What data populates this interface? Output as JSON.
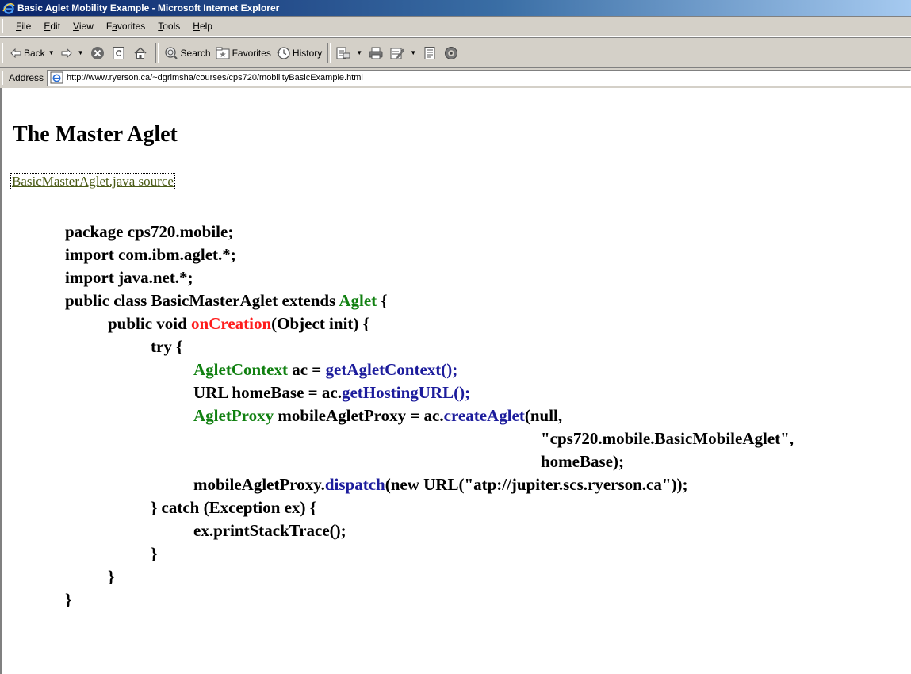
{
  "window": {
    "title": "Basic Aglet Mobility Example - Microsoft Internet Explorer"
  },
  "menu": [
    {
      "pre": "",
      "ul": "F",
      "post": "ile"
    },
    {
      "pre": "",
      "ul": "E",
      "post": "dit"
    },
    {
      "pre": "",
      "ul": "V",
      "post": "iew"
    },
    {
      "pre": "F",
      "ul": "a",
      "post": "vorites"
    },
    {
      "pre": "",
      "ul": "T",
      "post": "ools"
    },
    {
      "pre": "",
      "ul": "H",
      "post": "elp"
    }
  ],
  "toolbar": {
    "back": "Back",
    "search": "Search",
    "favorites": "Favorites",
    "history": "History",
    "icons": [
      "back-icon",
      "forward-icon",
      "stop-icon",
      "refresh-icon",
      "home-icon",
      "search-icon",
      "favorites-icon",
      "history-icon",
      "mail-icon",
      "print-icon",
      "edit-icon",
      "discuss-icon",
      "messenger-icon"
    ]
  },
  "address": {
    "label_pre": "A",
    "label_ul": "d",
    "label_post": "dress",
    "url": "http://www.ryerson.ca/~dgrimsha/courses/cps720/mobilityBasicExample.html"
  },
  "page": {
    "heading": "The Master Aglet",
    "source_link": "BasicMasterAglet.java source",
    "code": {
      "l1": "package cps720.mobile;",
      "l2": "import com.ibm.aglet.*;",
      "l3": "import java.net.*;",
      "l4a": "public class BasicMasterAglet extends ",
      "l4b": "Aglet",
      "l4c": " {",
      "l5a": "public void ",
      "l5b": "onCreation",
      "l5c": "(Object init) {",
      "l6": "try {",
      "l7a": "AgletContext",
      "l7b": " ac = ",
      "l7c": "getAgletContext();",
      "l8a": "URL homeBase = ac.",
      "l8b": "getHostingURL();",
      "l9a": "AgletProxy",
      "l9b": " mobileAgletProxy = ac.",
      "l9c": "createAglet",
      "l9d": "(null,",
      "l10": "\"cps720.mobile.BasicMobileAglet\",",
      "l11": "homeBase);",
      "l12a": "mobileAgletProxy.",
      "l12b": "dispatch",
      "l12c": "(new URL(\"atp://jupiter.scs.ryerson.ca\"));",
      "l13": "} catch (Exception ex) {",
      "l14": "ex.printStackTrace();",
      "l15": "}",
      "l16": "}",
      "l17": "}"
    }
  },
  "colors": {
    "type_green": "#108010",
    "method_red": "#ff1c1c",
    "call_blue": "#1c1c9c",
    "link": "#4a5a16"
  }
}
